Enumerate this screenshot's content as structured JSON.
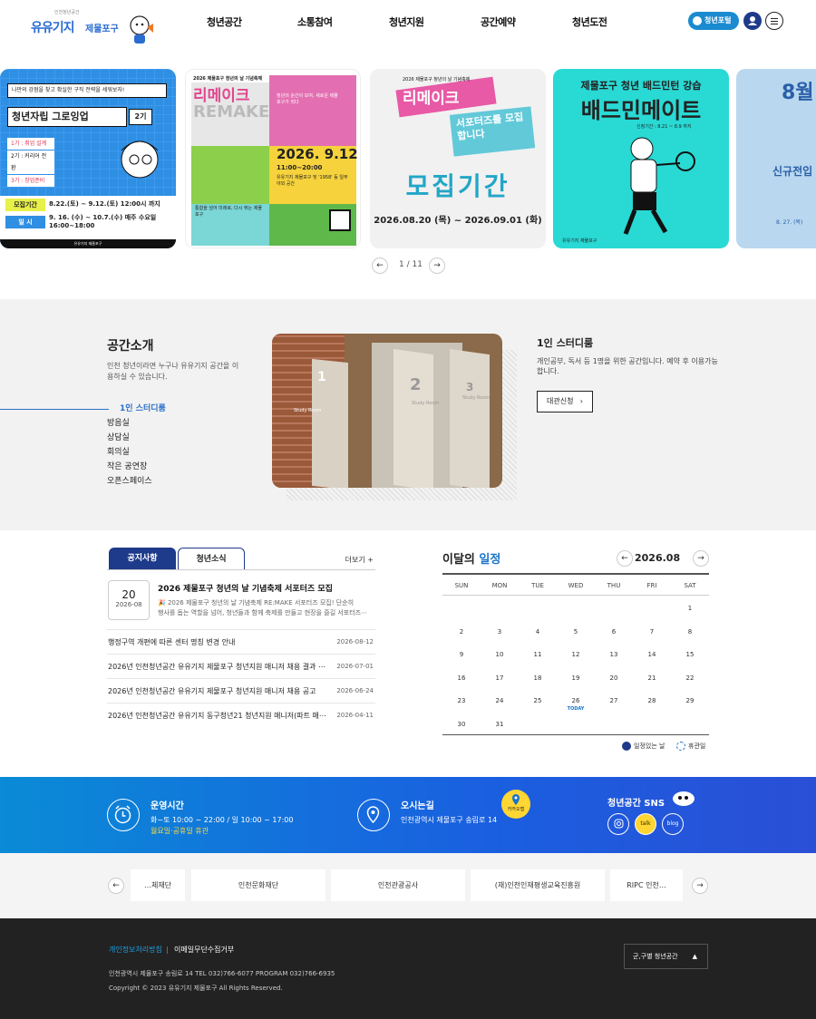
{
  "header": {
    "logo_sub": "인천청년공간",
    "logo_main": "유유기지",
    "logo_branch": "제물포구",
    "nav": [
      "청년공간",
      "소통참여",
      "청년지원",
      "공간예약",
      "청년도전"
    ],
    "portal_label": "청년포털"
  },
  "slider": {
    "card1": {
      "top": "나만의 강점을 찾고 확실한 구직 전략을 세워보자!",
      "title": "청년자립 그로잉업",
      "badge": "2기",
      "steps": [
        "1기 : 취업 설계",
        "2기 : 커리어 전환",
        "3기 : 창업준비"
      ],
      "period_label": "모집기간",
      "period": "8.22.(토) ~ 9.12.(토) 12:00시 까지",
      "date_label": "일 시",
      "date": "9. 16. (수) ~ 10.7.(수) 매주 수요일 16:00~18:00",
      "footer": "유유기지 제물포구"
    },
    "card2": {
      "top": "2026 제물포구 청년의 날 기념축제",
      "title": "리메이크",
      "title_en": "REMAKE",
      "desc": "청년의 순간이 모여, 새로운 제물포구가 되다",
      "date": "2026. 9.12",
      "time": "11:00~20:00",
      "place": "유유기지 제물포구 및 '1958' 등 일부 야외 공간",
      "bottom": "통합을 넘어 미래로, 다시 뛰는 제물포구"
    },
    "card3": {
      "top": "2026 제물포구 청년의 날 기념축제",
      "title": "리메이크",
      "badge": "서포터즈를 모집합니다",
      "big": "모집기간",
      "period": "2026.08.20 (목) ~ 2026.09.01 (화)"
    },
    "card4": {
      "title": "제물포구 청년 배드민턴 강습",
      "big": "배드민메이트",
      "period": "신청기간 : 8.21 ~ 8.9 까지",
      "footer": "유유기지 제물포구"
    },
    "card5": {
      "big": "8월",
      "title": "신규전입",
      "date": "8. 27. (목)"
    },
    "page": "1 / 11"
  },
  "space": {
    "title": "공간소개",
    "desc": "인천 청년이라면 누구나 유유기지 공간을 이용하실 수 있습니다.",
    "items": [
      "1인 스터디룸",
      "방음실",
      "상담실",
      "회의실",
      "작은 공연장",
      "오픈스페이스"
    ],
    "room_title": "1인 스터디룸",
    "room_desc": "개인공부, 독서 등 1명을 위한 공간입니다. 예약 후 이용가능합니다.",
    "room_btn": "대관신청",
    "photo_text": [
      "1",
      "Study Room",
      "2",
      "Study Room",
      "3",
      "Study Room"
    ]
  },
  "notice": {
    "tabs": [
      "공지사항",
      "청년소식"
    ],
    "more": "더보기 +",
    "featured": {
      "day": "20",
      "ym": "2026-08",
      "title": "2026 제물포구 청년의 날 기념축제 서포터즈 모집",
      "desc1": "🎉 2026 제물포구 청년의 날 기념축제 RE:MAKE 서포터즈 모집! 단순히",
      "desc2": "행사를 돕는 역할을 넘어, 청년들과 함께 축제를 만들고 현장을 즐길 서포터즈⋯"
    },
    "rows": [
      {
        "title": "행정구역 개편에 따른 센터 명칭 변경 안내",
        "date": "2026-08-12"
      },
      {
        "title": "2026년 인천청년공간 유유기지 제물포구 청년지원 매니저 채용 결과 ⋯",
        "date": "2026-07-01"
      },
      {
        "title": "2026년 인천청년공간 유유기지 제물포구 청년지원 매니저 채용 공고",
        "date": "2026-06-24"
      },
      {
        "title": "2026년 인천청년공간 유유기지 동구청년21 청년지원 매니저(파트 매⋯",
        "date": "2026-04-11"
      }
    ]
  },
  "calendar": {
    "title_pre": "이달의 ",
    "title_hl": "일정",
    "month": "2026.08",
    "weekdays": [
      "SUN",
      "MON",
      "TUE",
      "WED",
      "THU",
      "FRI",
      "SAT"
    ],
    "today_label": "TODAY",
    "today": 26,
    "first_weekday": 6,
    "days": 31,
    "legend": [
      "일정있는 날",
      "휴관일"
    ],
    "colors": {
      "accent": "#1a73c9",
      "event": "#1e3a8a"
    }
  },
  "info": {
    "hours_title": "운영시간",
    "hours": "화~토 10:00 ~ 22:00 / 일 10:00 ~ 17:00",
    "holiday": "월요일·공휴일 휴관",
    "loc_title": "오시는길",
    "loc": "인천광역시 제물포구 송림로 14",
    "kakao": "카카오맵",
    "sns_title": "청년공간 SNS",
    "sns": [
      "instagram",
      "talk",
      "blog"
    ]
  },
  "partners": [
    "…체재단",
    "인천문화재단",
    "인천관광공사",
    "(재)인천인재평생교육진흥원",
    "RIPC 인천…"
  ],
  "footer": {
    "privacy": "개인정보처리방침",
    "email": "이메일무단수집거부",
    "addr": "인천광역시 제물포구 송림로 14     TEL 032)766-6077     PROGRAM 032)766-6935",
    "copy": "Copyright © 2023 유유기지 제물포구 All Rights Reserved.",
    "select": "군,구별 청년공간"
  }
}
